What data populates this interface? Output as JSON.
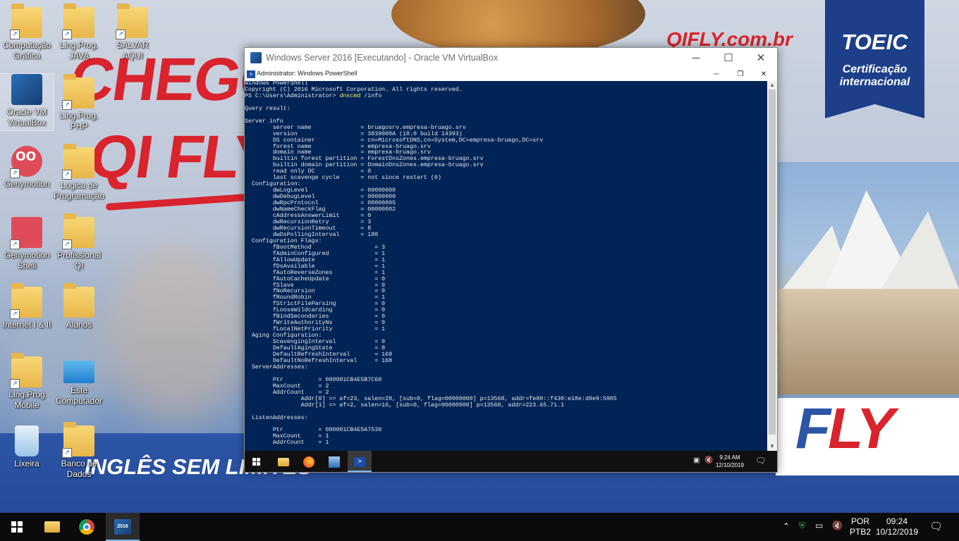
{
  "desktop": {
    "background_text": {
      "chegou": "CHEGO",
      "qifly": "QI FLY",
      "ingles": "INGLÊS SEM LIMITES",
      "url": "QIFLY.com.br",
      "toeic_title": "TOEIC",
      "toeic_sub1": "Certificação",
      "toeic_sub2": "internacional",
      "fly_logo_f": "F",
      "fly_logo_rest": "LY"
    },
    "icons": [
      {
        "label": "Computação Gráfica"
      },
      {
        "label": "Oracle VM VirtualBox"
      },
      {
        "label": "Genymotion"
      },
      {
        "label": "Genymotion Shell"
      },
      {
        "label": "Internet I & II"
      },
      {
        "label": "Ling.Prog Mobile"
      },
      {
        "label": "Lixeira"
      },
      {
        "label": "Ling.Prog. JAVA"
      },
      {
        "label": "Ling.Prog. PHP"
      },
      {
        "label": "Logica de Programação"
      },
      {
        "label": "Profissional QI"
      },
      {
        "label": "Alunos"
      },
      {
        "label": "Este Computador"
      },
      {
        "label": "Banco de Dados"
      },
      {
        "label": "SALVAR AQUI"
      }
    ]
  },
  "vbox_window": {
    "title": "Windows Server 2016 [Executando] - Oracle VM VirtualBox",
    "minimize": "─",
    "maximize": "☐",
    "close": "✕"
  },
  "powershell": {
    "title": "Administrator: Windows PowerShell",
    "minimize": "─",
    "restore": "❐",
    "close": "✕",
    "prompt": "PS C:\\Users\\Administrator> ",
    "command": "dnscmd",
    "args": " /info",
    "pre_lines": "Windows PowerShell\nCopyright (C) 2016 Microsoft Corporation. All rights reserved.\n",
    "output": "\nQuery result:\n\nServer info\n        server name              = bruagosrv.empresa-bruago.srv\n        version                  = 3839000A (10.0 build 14393)\n        DS container             = cn=MicrosoftDNS,cn=System,DC=empresa-bruago,DC=srv\n        forest name              = empresa-bruago.srv\n        domain name              = empresa-bruago.srv\n        builtin forest partition = ForestDnsZones.empresa-bruago.srv\n        builtin domain partition = DomainDnsZones.empresa-bruago.srv\n        read only DC             = 0\n        last scavenge cycle      = not since restart (0)\n  Configuration:\n        dwLogLevel               = 00000000\n        dwDebugLevel             = 00000000\n        dwRpcProtocol            = 00000005\n        dwNameCheckFlag          = 00000002\n        cAddressAnswerLimit      = 0\n        dwRecursionRetry         = 3\n        dwRecursionTimeout       = 8\n        dwDsPollingInterval      = 180\n  Configuration Flags:\n        fBootMethod                  = 3\n        fAdminConfigured             = 1\n        fAllowUpdate                 = 1\n        fDsAvailable                 = 1\n        fAutoReverseZones            = 1\n        fAutoCacheUpdate             = 0\n        fSlave                       = 0\n        fNoRecursion                 = 0\n        fRoundRobin                  = 1\n        fStrictFileParsing           = 0\n        fLooseWildcarding            = 0\n        fBindSecondaries             = 0\n        fWriteAuthorityNs            = 0\n        fLocalNetPriority            = 1\n  Aging Configuration:\n        ScavengingInterval           = 0\n        DefaultAgingState            = 0\n        DefaultRefreshInterval       = 168\n        DefaultNoRefreshInterval     = 168\n  ServerAddresses:\n\n        Ptr          = 000001CB4E5B7C60\n        MaxCount     = 2\n        AddrCount    = 2\n                Addr[0] => af=23, salen=28, [sub=0, flag=00000000] p=13568, addr=fe80::f430:e18e:d9e9:5905\n                Addr[1] => af=2, salen=16, [sub=0, flag=00000000] p=13568, addr=223.65.71.1\n\n  ListenAddresses:\n\n        Ptr          = 000001CB4E5A7530\n        MaxCount     = 1\n        AddrCount    = 1"
  },
  "guest_taskbar": {
    "time": "9:24 AM",
    "date": "12/10/2019"
  },
  "host_taskbar": {
    "vbox_icon_text": "2016",
    "lang1": "POR",
    "lang2": "PTB2",
    "time": "09:24",
    "date": "10/12/2019"
  },
  "colors": {
    "ps_background": "#012456",
    "ps_command": "#f2ea66",
    "brand_red": "#d9232d",
    "brand_blue": "#2d55a6"
  }
}
